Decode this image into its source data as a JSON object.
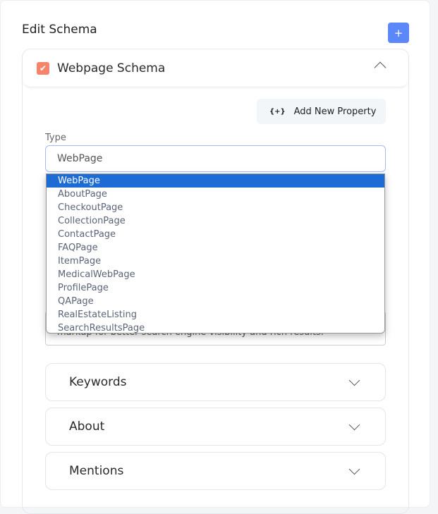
{
  "header": {
    "title": "Edit Schema",
    "add_label": "+"
  },
  "schema": {
    "title": "Webpage Schema",
    "checked": true,
    "add_property_label": "Add New Property",
    "add_property_icon": "{+}"
  },
  "type_field": {
    "label": "Type",
    "value": "WebPage"
  },
  "dropdown": {
    "selected": "WebPage",
    "options": [
      "WebPage",
      "AboutPage",
      "CheckoutPage",
      "CollectionPage",
      "ContactPage",
      "FAQPage",
      "ItemPage",
      "MedicalWebPage",
      "ProfilePage",
      "QAPage",
      "RealEstateListing",
      "SearchResultsPage"
    ]
  },
  "description": {
    "value_visible": "markup for better search engine visibility and rich results."
  },
  "sections": [
    {
      "label": "Keywords"
    },
    {
      "label": "About"
    },
    {
      "label": "Mentions"
    }
  ],
  "colors": {
    "accent": "#5b87f8",
    "checkbox": "#f5856a",
    "selected_option": "#1d6bd4"
  }
}
